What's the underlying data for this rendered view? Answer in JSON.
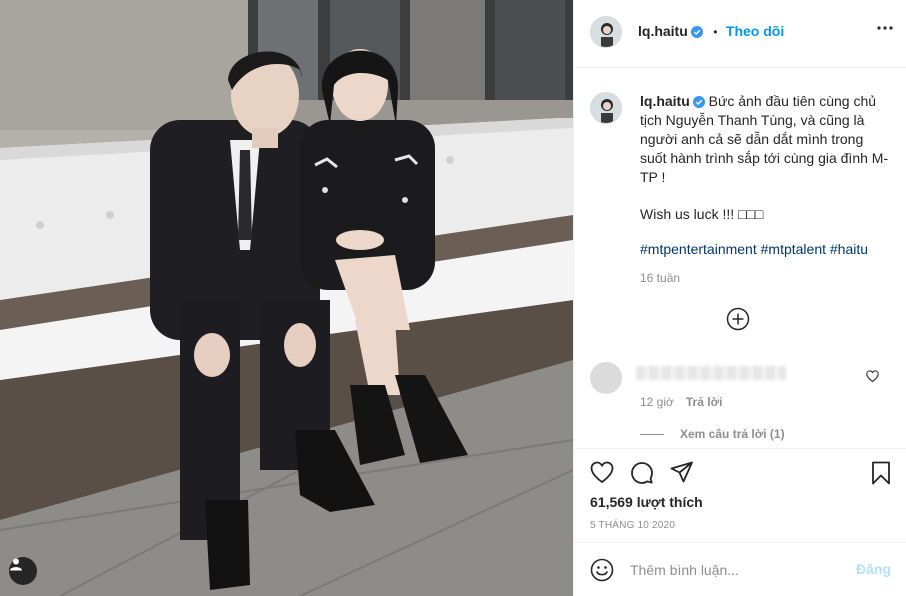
{
  "account": {
    "username": "lq.haitu",
    "follow_label": "Theo dõi",
    "separator": "•"
  },
  "caption": {
    "username": "lq.haitu",
    "text": "Bức ảnh đầu tiên cùng chủ tịch Nguyễn Thanh Tùng, và cũng là người anh cả sẽ dẫn dắt mình trong suốt hành trình sắp tới cùng gia đình M-TP !",
    "wish": "Wish us luck !!! □□□",
    "hashtags": "#mtpentertainment #mtptalent #haitu",
    "time_ago": "16 tuần"
  },
  "comment": {
    "time": "12 giờ",
    "reply_label": "Trả lời",
    "view_replies": "Xem câu trả lời (1)"
  },
  "stats": {
    "likes": "61,569 lượt thích",
    "date": "5 THÁNG 10 2020"
  },
  "comment_box": {
    "placeholder": "Thêm bình luận...",
    "post_label": "Đăng"
  },
  "colors": {
    "link_blue": "#0095f6",
    "hashtag": "#00376b",
    "muted": "#8e8e8e",
    "post_disabled": "#b2dffc"
  }
}
